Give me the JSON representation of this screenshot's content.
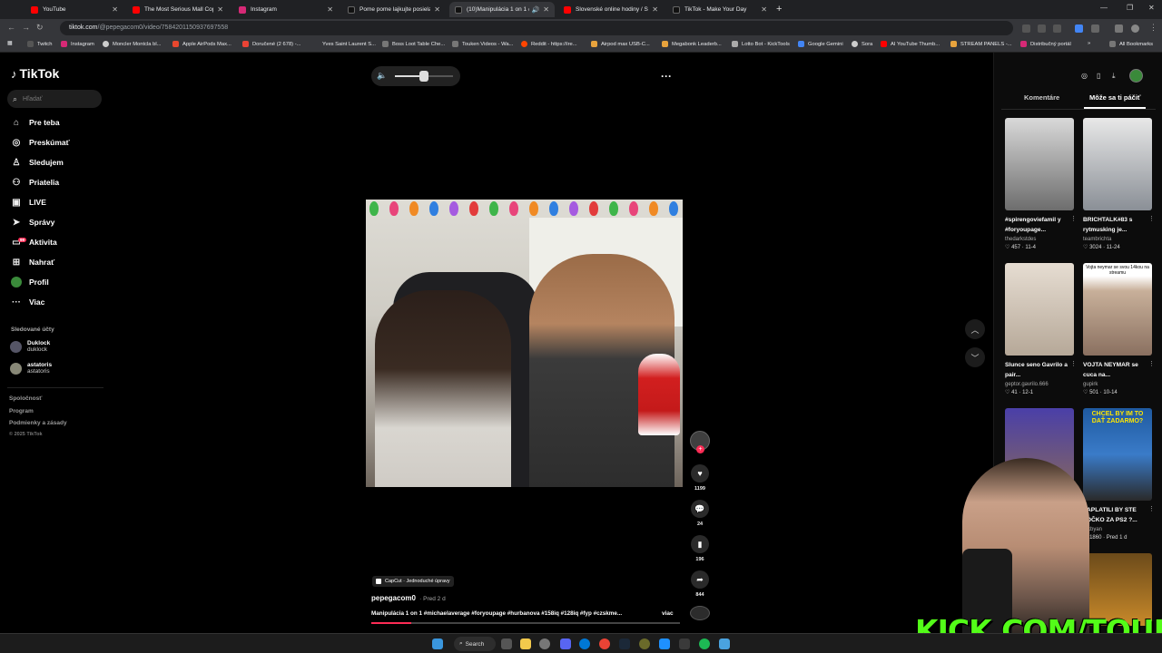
{
  "browser": {
    "tabs": [
      {
        "title": "YouTube",
        "color": "#ff0000"
      },
      {
        "title": "The Most Serious Mall Cop - Yo",
        "color": "#ff0000"
      },
      {
        "title": "Instagram",
        "color": "#d62976"
      },
      {
        "title": "Pome pome lajkujte posielajte",
        "color": "#111111"
      },
      {
        "title": "(10)Manipulácia 1 on 1 #mi",
        "color": "#111111"
      },
      {
        "title": "Slovenské online hodiny / Slov",
        "color": "#ff0000"
      },
      {
        "title": "TikTok - Make Your Day",
        "color": "#111111"
      }
    ],
    "url_host": "tiktok.com",
    "url_path": "/@pepegacom0/video/7584201150937697558",
    "bookmarks": [
      "Twitch",
      "Instagram",
      "Moncler Montcla bl...",
      "Apple AirPods Max...",
      "Doručené (2 678) -...",
      "Yves Saint Laurent S...",
      "Boss Loot Table Che...",
      "Touken Videos - Wa...",
      "Reddit - https://ire...",
      "Airpod max USB-C...",
      "Megabonk Leaderb...",
      "Lotto Bot - KickTools",
      "Google Gemini",
      "Sora",
      "AI YouTube Thumb...",
      "STREAM PANELS -...",
      "Distribučný portál"
    ],
    "all_bookmarks": "All Bookmarks"
  },
  "tiktok": {
    "logo": "TikTok",
    "search_placeholder": "Hľadať",
    "nav": [
      {
        "label": "Pre teba",
        "icon": "home-icon"
      },
      {
        "label": "Preskúmať",
        "icon": "compass-icon"
      },
      {
        "label": "Sledujem",
        "icon": "following-icon"
      },
      {
        "label": "Priatelia",
        "icon": "friends-icon"
      },
      {
        "label": "LIVE",
        "icon": "live-icon"
      },
      {
        "label": "Správy",
        "icon": "messages-icon"
      },
      {
        "label": "Aktivita",
        "icon": "activity-icon"
      },
      {
        "label": "Nahrať",
        "icon": "upload-icon"
      },
      {
        "label": "Profil",
        "icon": "profile-avatar"
      },
      {
        "label": "Viac",
        "icon": "more-icon"
      }
    ],
    "activity_badge": "99",
    "following_heading": "Sledované účty",
    "following": [
      {
        "name": "Duklock",
        "handle": "duklock"
      },
      {
        "name": "astatoris",
        "handle": "astatoris"
      }
    ],
    "footer": [
      "Spoločnosť",
      "Program",
      "Podmienky a zásady"
    ],
    "copyright": "© 2025 TikTok"
  },
  "player": {
    "volume_level": 0.5,
    "capcut_label": "CapCut · Jednoduché úpravy",
    "author": "pepegacom0",
    "posted": "· Pred 2 d",
    "caption": "Manipulácia 1 on 1 #michaelaverage #foryoupage #hurbanova #158iq #128iq #fyp #czskme...",
    "more_label": "viac",
    "progress": 0.13,
    "likes": "1199",
    "comments": "24",
    "saves": "196",
    "shares": "844"
  },
  "right_panel": {
    "tab_comments": "Komentáre",
    "tab_recommended": "Môže sa ti páčiť",
    "cards": [
      {
        "title": "#spirengoviefamil y #foryoupage...",
        "author": "thedarkstdes",
        "views": "457",
        "date": "11-4",
        "color": "#8a8a8a"
      },
      {
        "title": "BRICHTALK#83 s rytmusking je...",
        "author": "teambrichta",
        "views": "3024",
        "date": "11-24",
        "color": "#cfcfcf"
      },
      {
        "title": "Slunce seno Gavrilo a pair...",
        "author": "geptor.gavrilo.666",
        "views": "41",
        "date": "12-1",
        "color": "#c9bfb5"
      },
      {
        "title": "VOJTA NEYMAR se cuca na...",
        "author": "gupirk",
        "views": "501",
        "date": "10-14",
        "color": "#b59b85"
      },
      {
        "title": "",
        "author": "",
        "views": "",
        "date": "",
        "color": "#4a3fa8"
      },
      {
        "title": "ZAPLATILI BY STE TOČKO ZA PS2 ?...",
        "author": "fakbyan",
        "views": "1860",
        "date": "Pred 1 d",
        "color": "#2f6fb0"
      }
    ],
    "thumb_text_2": "Vojta neymar se svou 14kou na streamu",
    "thumb_text_4": "CHCEL BY IM TO DAŤ ZADARMO?"
  },
  "overlay": {
    "kick_text": "KICK.COM/TOUKEN"
  },
  "taskbar": {
    "search_label": "Search"
  }
}
